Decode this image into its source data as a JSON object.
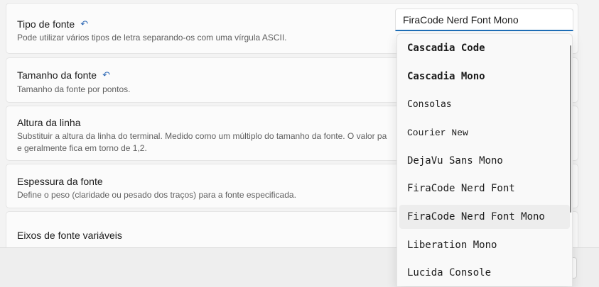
{
  "settings": [
    {
      "title": "Tipo de fonte",
      "has_reset": true,
      "description": "Pode utilizar vários tipos de letra separando-os com uma vírgula ASCII."
    },
    {
      "title": "Tamanho da fonte",
      "has_reset": true,
      "description": "Tamanho da fonte por pontos."
    },
    {
      "title": "Altura da linha",
      "has_reset": false,
      "description": "Substituir a altura da linha do terminal. Medido como um múltiplo do tamanho da fonte. O valor pa",
      "description_line2": "e geralmente fica em torno de 1,2."
    },
    {
      "title": "Espessura da fonte",
      "has_reset": false,
      "description": "Define o peso (claridade ou pesado dos traços) para a fonte especificada."
    },
    {
      "title": "Eixos de fonte variáveis",
      "has_reset": false
    }
  ],
  "reset_icon": "reset-arrow-icon",
  "font_input": {
    "value": "FiraCode Nerd Font Mono"
  },
  "dropdown": {
    "selected_index": 6,
    "items": [
      "Cascadia Code",
      "Cascadia Mono",
      "Consolas",
      "Courier New",
      "DejaVu Sans Mono",
      "FiraCode Nerd Font",
      "FiraCode Nerd Font Mono",
      "Liberation Mono",
      "Lucida Console"
    ]
  },
  "colors": {
    "accent": "#1f6fb8",
    "reset_icon": "#2b66b4",
    "selected_item_bg": "#ededed"
  }
}
